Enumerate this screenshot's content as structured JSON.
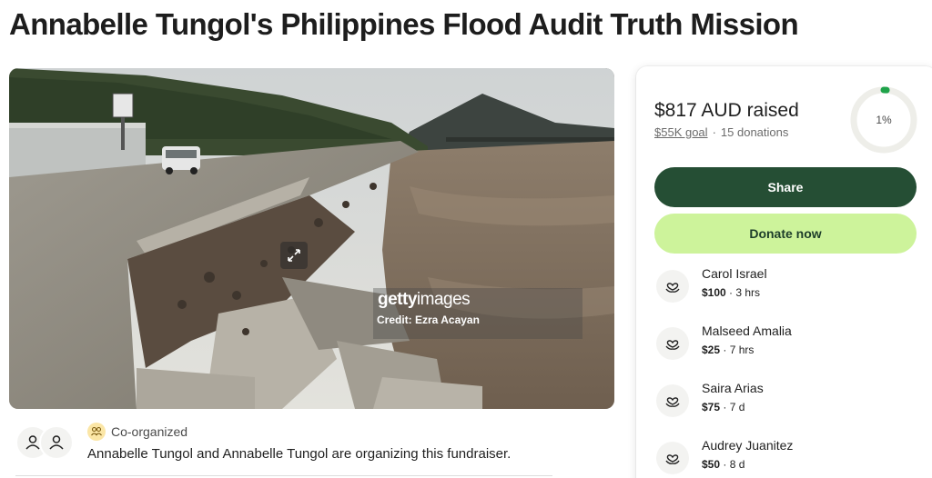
{
  "page": {
    "title": "Annabelle Tungol's Philippines Flood Audit Truth Mission"
  },
  "hero": {
    "watermark_logo_bold": "getty",
    "watermark_logo_light": "images",
    "watermark_credit": "Credit: Ezra Acayan",
    "expand_icon": "expand-arrows-icon"
  },
  "organizer": {
    "badge_label": "Co-organized",
    "badge_icon": "people-group-icon",
    "avatar_icon": "person-icon",
    "text": "Annabelle Tungol and Annabelle Tungol are organizing this fundraiser."
  },
  "donation": {
    "raised_label": "$817 AUD raised",
    "goal_label": "$55K goal",
    "separator": "·",
    "donation_count_label": "15 donations",
    "progress_percent_label": "1%",
    "progress_fraction": 0.015,
    "share_label": "Share",
    "donate_label": "Donate now",
    "donor_icon": "heart-in-hand-icon"
  },
  "donors": [
    {
      "name": "Carol Israel",
      "amount": "$100",
      "time": " · 3 hrs"
    },
    {
      "name": "Malseed Amalia",
      "amount": "$25",
      "time": " · 7 hrs"
    },
    {
      "name": "Saira Arias",
      "amount": "$75",
      "time": " · 7 d"
    },
    {
      "name": "Audrey Juanitez",
      "amount": "$50",
      "time": " · 8 d"
    }
  ],
  "colors": {
    "share_button": "#254e34",
    "donate_button": "#cdf39b",
    "progress_accent": "#1fa34a"
  }
}
